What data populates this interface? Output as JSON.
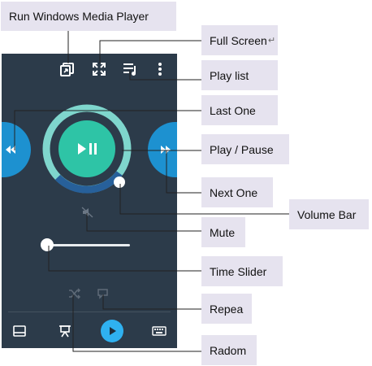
{
  "callouts": {
    "run_wmp": "Run Windows Media Player",
    "full_screen": "Full Screen",
    "full_screen_mark": "↵",
    "play_list": "Play list",
    "last_one": "Last One",
    "play_pause": "Play / Pause",
    "next_one": "Next One",
    "volume_bar": "Volume Bar",
    "mute": "Mute",
    "time_slider": "Time Slider",
    "repeat": "Repea",
    "random": "Radom"
  },
  "player": {
    "time_progress": 0.0,
    "volume_level": 0.62
  },
  "colors": {
    "panel_bg": "#2c3b4a",
    "accent_teal": "#2ec4a6",
    "ring_light": "#7fd6cd",
    "ring_dark": "#27609a",
    "side_blue": "#1d91d0",
    "nav_play": "#2fb1f0",
    "callout_bg": "#e6e3ef"
  },
  "icons": [
    "external-window-icon",
    "expand-icon",
    "playlist-icon",
    "more-vert-icon",
    "rewind-icon",
    "play-pause-icon",
    "fast-forward-icon",
    "mute-icon",
    "shuffle-icon",
    "repeat-icon",
    "monitor-icon",
    "presentation-icon",
    "play-icon",
    "keyboard-icon"
  ]
}
